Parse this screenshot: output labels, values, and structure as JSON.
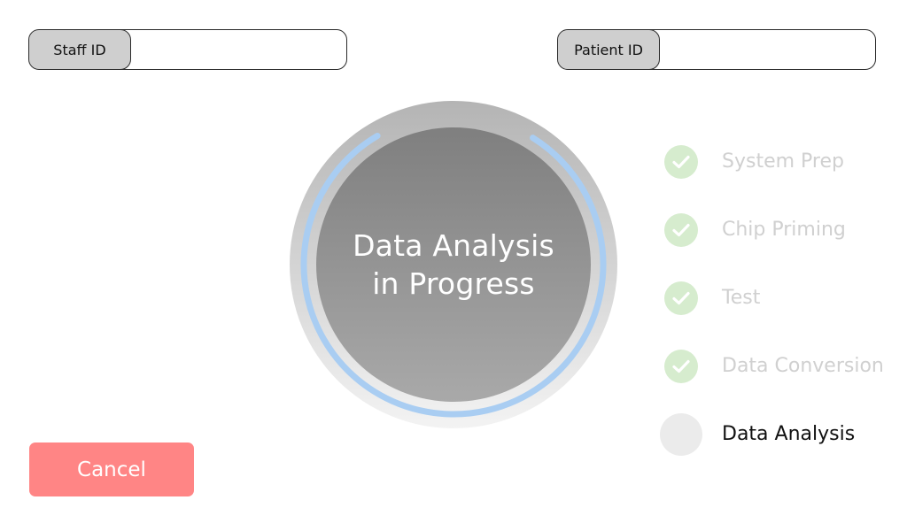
{
  "header": {
    "staff_id": {
      "label": "Staff ID",
      "value": "",
      "placeholder": ""
    },
    "patient_id": {
      "label": "Patient ID",
      "value": "",
      "placeholder": ""
    }
  },
  "progress": {
    "line1": "Data Analysis",
    "line2": "in Progress",
    "colors": {
      "outer_top": "#b4b4b4",
      "outer_bottom": "#f3f3f3",
      "inner_top": "#7f7f7f",
      "inner_bottom": "#a9a9a9",
      "arc": "#a9cdf2"
    }
  },
  "steps": [
    {
      "label": "System Prep",
      "status": "done",
      "icon": "check-icon"
    },
    {
      "label": "Chip Priming",
      "status": "done",
      "icon": "check-icon"
    },
    {
      "label": "Test",
      "status": "done",
      "icon": "check-icon"
    },
    {
      "label": "Data Conversion",
      "status": "done",
      "icon": "check-icon"
    },
    {
      "label": "Data Analysis",
      "status": "current",
      "icon": "pending-circle-icon"
    }
  ],
  "actions": {
    "cancel_label": "Cancel",
    "cancel_color": "#ff8585"
  },
  "colors": {
    "done_check_bg": "#d6ecce",
    "done_label": "#d0d0d0",
    "current_label": "#111111",
    "pending_bg": "#ebebeb"
  }
}
